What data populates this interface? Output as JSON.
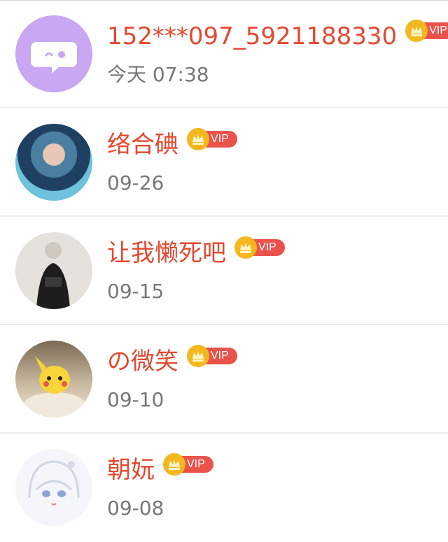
{
  "contacts": [
    {
      "name": "152***097_5921188330",
      "time": "今天 07:38",
      "vip_label": "VIP",
      "avatar": "chat-bubble-icon"
    },
    {
      "name": "络合碘",
      "time": "09-26",
      "vip_label": "VIP",
      "avatar": "user-photo"
    },
    {
      "name": "让我懒死吧",
      "time": "09-15",
      "vip_label": "VIP",
      "avatar": "user-photo"
    },
    {
      "name": "の微笑",
      "time": "09-10",
      "vip_label": "VIP",
      "avatar": "pikachu-photo"
    },
    {
      "name": "朝妧",
      "time": "09-08",
      "vip_label": "VIP",
      "avatar": "anime-girl-drawing"
    }
  ],
  "colors": {
    "name": "#e4482f",
    "vip_pill": "#e9534c",
    "vip_coin": "#f4b81e",
    "date": "#777777",
    "default_avatar_bg": "#c9a7f3"
  }
}
